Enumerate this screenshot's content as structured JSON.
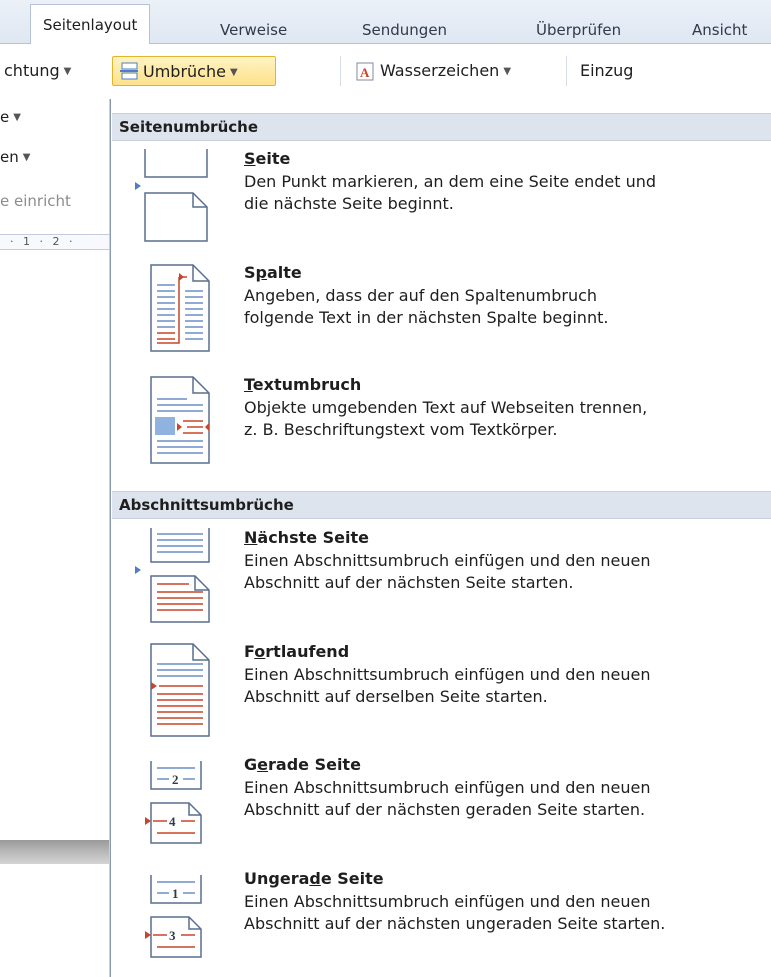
{
  "tabs": [
    "Seitenlayout",
    "Verweise",
    "Sendungen",
    "Überprüfen",
    "Ansicht"
  ],
  "ribbon": {
    "partial_button": "chtung",
    "breaks_button": "Umbrüche",
    "watermark_button": "Wasserzeichen",
    "indent_label": "Einzug"
  },
  "left_strip": {
    "row1": "e",
    "row2": "en",
    "group_label": "e einricht",
    "ruler": "· 1 · 2 ·"
  },
  "sections": [
    {
      "header": "Seitenumbrüche",
      "items": [
        {
          "title_u": "S",
          "title_rest": "eite",
          "desc": [
            "Den Punkt markieren, an dem eine Seite endet und",
            "die nächste Seite beginnt."
          ],
          "icon": "page-break-icon"
        },
        {
          "title_pre": "S",
          "title_u": "p",
          "title_rest": "alte",
          "desc": [
            "Angeben, dass der auf den Spaltenumbruch",
            "folgende Text in der nächsten Spalte beginnt."
          ],
          "icon": "column-break-icon"
        },
        {
          "title_u": "T",
          "title_rest": "extumbruch",
          "desc": [
            "Objekte umgebenden Text auf Webseiten trennen,",
            "z. B. Beschriftungstext vom Textkörper."
          ],
          "icon": "text-wrapping-break-icon"
        }
      ]
    },
    {
      "header": "Abschnittsumbrüche",
      "items": [
        {
          "title_u": "N",
          "title_rest": "ächste Seite",
          "desc": [
            "Einen Abschnittsumbruch einfügen und den neuen",
            "Abschnitt auf der nächsten Seite starten."
          ],
          "icon": "next-page-break-icon"
        },
        {
          "title_pre": "F",
          "title_u": "o",
          "title_rest": "rtlaufend",
          "desc": [
            "Einen Abschnittsumbruch einfügen und den neuen",
            "Abschnitt auf derselben Seite starten."
          ],
          "icon": "continuous-break-icon"
        },
        {
          "title_pre": "G",
          "title_u": "e",
          "title_rest": "rade Seite",
          "desc": [
            "Einen Abschnittsumbruch einfügen und den neuen",
            "Abschnitt auf der nächsten geraden Seite starten."
          ],
          "icon": "even-page-break-icon",
          "page_numbers": [
            "2",
            "4"
          ]
        },
        {
          "title_pre": "Ungera",
          "title_u": "d",
          "title_rest": "e Seite",
          "desc": [
            "Einen Abschnittsumbruch einfügen und den neuen",
            "Abschnitt auf der nächsten ungeraden Seite starten."
          ],
          "icon": "odd-page-break-icon",
          "page_numbers": [
            "1",
            "3"
          ]
        }
      ]
    }
  ],
  "colors": {
    "accent_red": "#c8452a",
    "accent_blue": "#4d7fc4",
    "header_bg": "#dde4ed",
    "highlight": "#fde28a"
  }
}
